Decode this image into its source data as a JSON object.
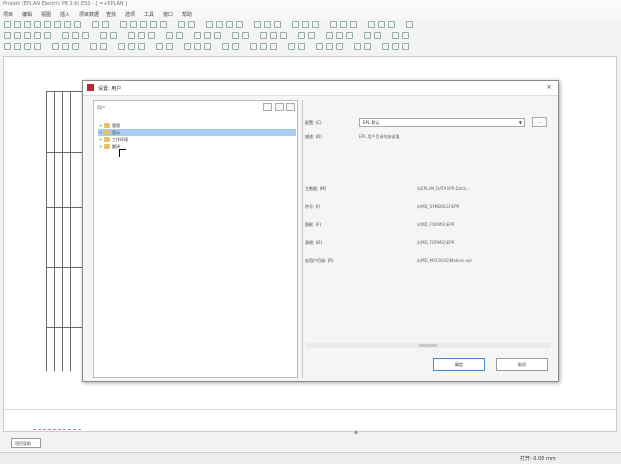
{
  "app": {
    "title": "Projekt (EPLAN Electric P8 2.6) ESS - [ =+EPLAN ]",
    "menu": [
      "项目",
      "编辑",
      "视图",
      "插入",
      "项目数据",
      "查找",
      "选项",
      "工具",
      "窗口",
      "帮助"
    ]
  },
  "dialog": {
    "title": "设置: 用户",
    "tree_label": "用户",
    "tree_items": [
      {
        "label": "管理",
        "expanded": false,
        "selected": false
      },
      {
        "label": "显示",
        "expanded": false,
        "selected": true
      },
      {
        "label": "工作环境",
        "expanded": false,
        "selected": false
      },
      {
        "label": "翻译",
        "expanded": false,
        "selected": false
      }
    ],
    "scheme_label": "配置: (C)",
    "scheme_value": "EPL 默认",
    "scheme_more": "...",
    "description_label": "描述: (D)",
    "description_value": "EPL 用户目录的缺省值",
    "paths": [
      {
        "label": "主数据: (M)",
        "value": "$(EPLAN_DATA)\\PR-Data\\..."
      },
      {
        "label": "符号: (I)",
        "value": "$(MD_SYMBOLS)\\EPR"
      },
      {
        "label": "图框: (F)",
        "value": "$(MD_FORMS)\\EPR"
      },
      {
        "label": "表格: (O)",
        "value": "$(MD_FORMS)\\EPR"
      },
      {
        "label": "宏用户目录: (R)",
        "value": "$(MD_MACROS)\\Makros.epr"
      }
    ],
    "ok_label": "确定",
    "cancel_label": "取消"
  },
  "footer": {
    "sheet_tab": "项目导航",
    "status_text": "打开: 0.00 mm"
  }
}
